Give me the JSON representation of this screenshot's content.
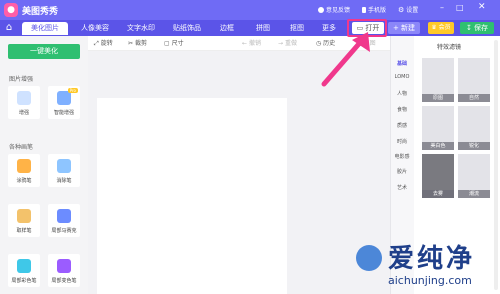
{
  "titlebar": {
    "app_title": "美图秀秀",
    "feedback": "意见反馈",
    "mobile": "手机版",
    "settings": "设置"
  },
  "menu": {
    "tabs": [
      "美化图片",
      "人像美容",
      "文字水印",
      "贴纸饰品",
      "边框",
      "拼图",
      "抠图",
      "更多"
    ],
    "open": "打开",
    "new": "新建",
    "vip": "会员",
    "save": "保存"
  },
  "sidebar": {
    "one_key": "一键美化",
    "section1": "图片增强",
    "section2": "各种画笔",
    "tools": [
      {
        "label": "增强",
        "icon": "enhance-icon",
        "pro": ""
      },
      {
        "label": "智能增强",
        "icon": "magic-wand-icon",
        "pro": "Pro"
      },
      {
        "label": "涂鸦笔",
        "icon": "brush-icon",
        "pro": ""
      },
      {
        "label": "消除笔",
        "icon": "eraser-icon",
        "pro": ""
      },
      {
        "label": "取样笔",
        "icon": "sample-brush-icon",
        "pro": ""
      },
      {
        "label": "局部马赛克",
        "icon": "mosaic-icon",
        "pro": ""
      },
      {
        "label": "局部彩色笔",
        "icon": "color-pen-icon",
        "pro": ""
      },
      {
        "label": "局部变色笔",
        "icon": "change-color-icon",
        "pro": ""
      }
    ]
  },
  "toolbar": {
    "rotate": "旋转",
    "crop": "裁剪",
    "size": "尺寸",
    "undo": "撤销",
    "redo": "重做",
    "history": "历史",
    "original": "原图"
  },
  "categories": [
    "基础",
    "LOMO",
    "人物",
    "食物",
    "质感",
    "时尚",
    "电影感",
    "胶片",
    "艺术"
  ],
  "filters": {
    "title": "特效滤镜",
    "items": [
      "原图",
      "自然",
      "美白色",
      "锐化",
      "去雾",
      "潮流"
    ]
  },
  "watermark": {
    "cn": "爱纯净",
    "en": "aichunjing.com"
  },
  "colors": {
    "brand": "#5b54e8",
    "titlebar": "#6f6bf5",
    "save": "#2fbf71",
    "highlight": "#f0388c"
  }
}
